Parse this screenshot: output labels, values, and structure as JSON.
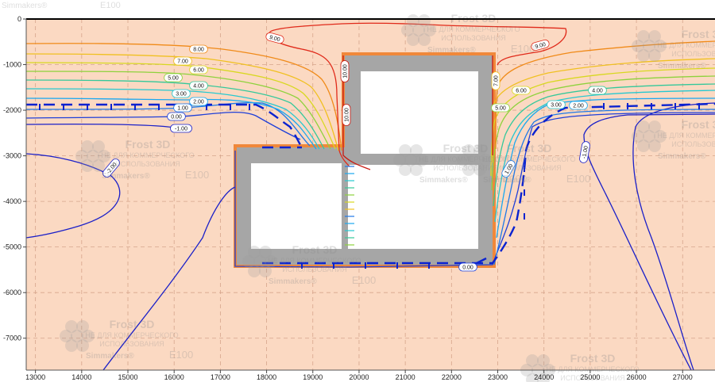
{
  "chart_data": {
    "type": "contour",
    "x_ticks": [
      "13000",
      "14000",
      "15000",
      "16000",
      "17000",
      "18000",
      "19000",
      "20000",
      "21000",
      "22000",
      "23000",
      "24000",
      "25000",
      "26000",
      "27000"
    ],
    "y_ticks": [
      "0",
      "-1000",
      "-2000",
      "-3000",
      "-4000",
      "-5000",
      "-6000",
      "-7000"
    ],
    "xlim": [
      12800,
      27700
    ],
    "ylim": [
      -7700,
      0
    ],
    "grid": "dashed",
    "colors": {
      "ground": "#fbd9c2",
      "wall": "#a6a6a6",
      "hull": "#f0883a",
      "room": "#ffffff",
      "freeze_front": "#0a22d0"
    },
    "contour_labels": [
      "-2.00",
      "-1.00",
      "0.00",
      "1.00",
      "2.00",
      "3.00",
      "4.00",
      "5.00",
      "6.00",
      "7.00",
      "8.00",
      "9.00",
      "10.00"
    ],
    "levels": [
      {
        "value": "-2.00",
        "color": "#1b20c8"
      },
      {
        "value": "-1.00",
        "color": "#1b20c8"
      },
      {
        "value": "0.00",
        "color": "#1f3fd8"
      },
      {
        "value": "1.00",
        "color": "#1e78e8"
      },
      {
        "value": "2.00",
        "color": "#1aa8f0"
      },
      {
        "value": "3.00",
        "color": "#26c8d0"
      },
      {
        "value": "4.00",
        "color": "#35c89a"
      },
      {
        "value": "5.00",
        "color": "#8ed23c"
      },
      {
        "value": "6.00",
        "color": "#d8d820"
      },
      {
        "value": "7.00",
        "color": "#f0c020"
      },
      {
        "value": "8.00",
        "color": "#f08a18"
      },
      {
        "value": "9.00",
        "color": "#e02a1a"
      },
      {
        "value": "10.00",
        "color": "#c81a12"
      }
    ],
    "series": []
  },
  "watermarks": [
    {
      "line1": "Frost 3D",
      "line2": "НЕ ДЛЯ КОММЕРЧЕСКОГО",
      "line3": "ИСПОЛЬЗОВАНИЯ",
      "brand": "Simmakers®",
      "code": "E100"
    }
  ],
  "header_watermark": {
    "brand": "Simmakers®",
    "code": "E100"
  }
}
